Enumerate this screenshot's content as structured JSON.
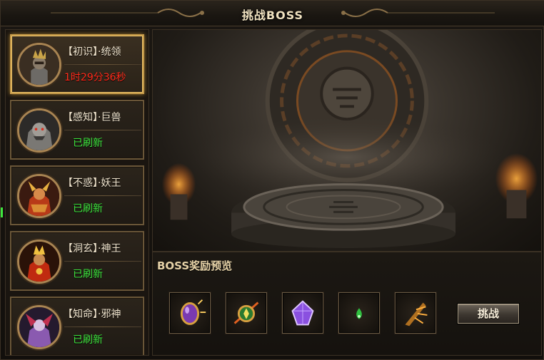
{
  "window": {
    "title": "挑战BOSS"
  },
  "bosses": [
    {
      "name": "【初识】·统领",
      "status": "1时29分36秒",
      "state": "timer",
      "selected": true
    },
    {
      "name": "【感知】·巨兽",
      "status": "已刷新",
      "state": "ready",
      "selected": false
    },
    {
      "name": "【不惑】·妖王",
      "status": "已刷新",
      "state": "ready",
      "selected": false
    },
    {
      "name": "【洞玄】·神王",
      "status": "已刷新",
      "state": "ready",
      "selected": false
    },
    {
      "name": "【知命】·邪神",
      "status": "已刷新",
      "state": "ready",
      "selected": false
    }
  ],
  "rewards": {
    "title": "BOSS奖励预览",
    "items": [
      {
        "icon": "purple-egg-icon"
      },
      {
        "icon": "green-orb-icon"
      },
      {
        "icon": "violet-gem-icon"
      },
      {
        "icon": "green-drop-icon"
      },
      {
        "icon": "golden-wing-icon"
      }
    ]
  },
  "actions": {
    "challenge_label": "挑战"
  },
  "colors": {
    "timer": "#ff2a1a",
    "ready": "#3ee63e",
    "frame": "#c59a4a",
    "text": "#f2e6cf"
  }
}
